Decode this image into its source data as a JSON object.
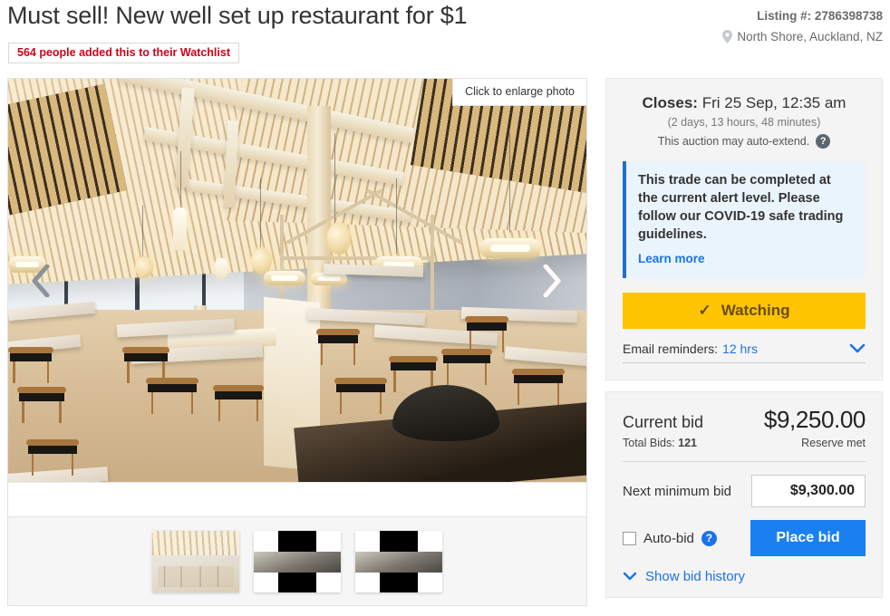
{
  "listing": {
    "title": "Must sell! New well set up restaurant for $1",
    "watchlist_badge": "564 people added this to their Watchlist",
    "listing_number_label": "Listing #: 2786398738",
    "location": "North Shore, Auckland, NZ"
  },
  "gallery": {
    "enlarge_tip": "Click to enlarge photo",
    "prev_icon": "chevron-left-icon",
    "next_icon": "chevron-right-icon",
    "thumbnails": [
      {
        "name": "thumbnail-1"
      },
      {
        "name": "thumbnail-2"
      },
      {
        "name": "thumbnail-3"
      }
    ]
  },
  "auction": {
    "closes_label": "Closes:",
    "closes_value": "Fri 25 Sep, 12:35 am",
    "time_remaining": "(2 days, 13 hours, 48 minutes)",
    "auto_extend_note": "This auction may auto-extend.",
    "help_icon_glyph": "?",
    "covid_message": "This trade can be completed at the current alert level. Please follow our COVID-19 safe trading guidelines.",
    "covid_learn_more": "Learn more",
    "watch_button_label": "Watching",
    "watch_check_glyph": "✓",
    "reminders_label": "Email reminders:",
    "reminders_value": "12 hrs",
    "reminders_chevron": "⌄"
  },
  "bidding": {
    "current_bid_label": "Current bid",
    "current_bid_amount": "$9,250.00",
    "total_bids_label": "Total Bids:",
    "total_bids_value": "121",
    "reserve_status": "Reserve met",
    "next_min_label": "Next minimum bid",
    "next_min_value": "$9,300.00",
    "autobid_label": "Auto-bid",
    "autobid_help_glyph": "?",
    "place_bid_label": "Place bid",
    "bid_history_label": "Show bid history",
    "bid_history_chevron": "⌄"
  },
  "colors": {
    "accent_blue": "#1a7ff0",
    "link_blue": "#1a73e8",
    "watch_amber": "#ffc400",
    "alert_red": "#d0021b",
    "panel_bg": "#f4f4f4"
  }
}
